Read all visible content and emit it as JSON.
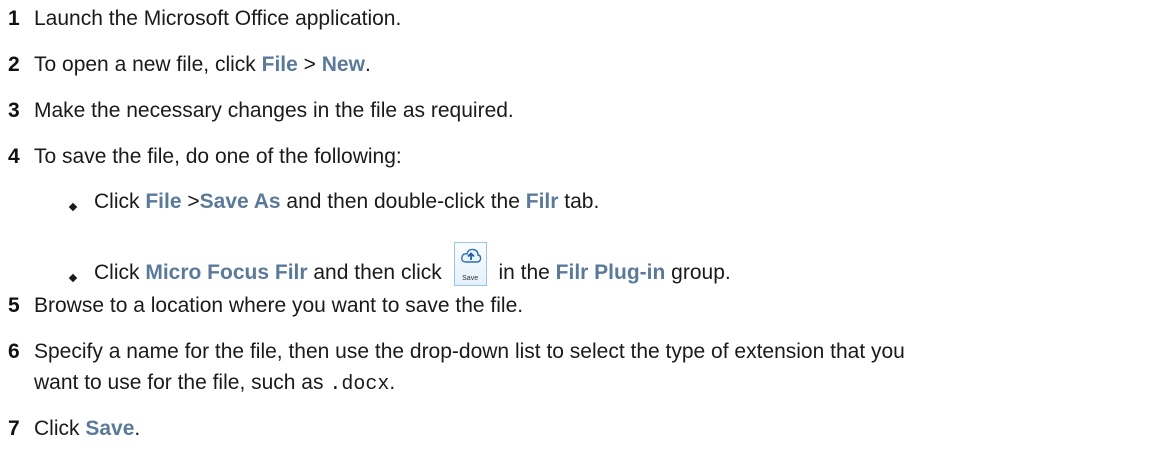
{
  "steps": [
    {
      "num": "1",
      "text": "Launch the Microsoft Office application."
    },
    {
      "num": "2",
      "pre": "To open a new file, click ",
      "ui1": "File",
      "mid": " > ",
      "ui2": "New",
      "post": "."
    },
    {
      "num": "3",
      "text": "Make the necessary changes in the file as required."
    },
    {
      "num": "4",
      "text": "To save the file, do one of the following:"
    },
    {
      "num": "5",
      "text": "Browse to a location where you want to save the file."
    },
    {
      "num": "6",
      "line1": "Specify a name for the file, then use the drop-down list to select the type of extension that you",
      "line2_pre": "want to use for the file, such as ",
      "code": ".docx",
      "line2_post": "."
    },
    {
      "num": "7",
      "pre": "Click ",
      "ui": "Save",
      "post": "."
    }
  ],
  "substeps": [
    {
      "pre": "Click ",
      "ui1": "File",
      "mid1": " >",
      "ui2": "Save As",
      "mid2": " and then double-click the ",
      "ui3": "Filr",
      "post": " tab."
    },
    {
      "pre": "Click ",
      "ui1": "Micro Focus Filr",
      "mid1": " and then click ",
      "icon": "cloud-upload-save-icon",
      "icon_label": "Save",
      "mid2": " in the ",
      "ui2": "Filr Plug-in",
      "post": " group."
    }
  ]
}
